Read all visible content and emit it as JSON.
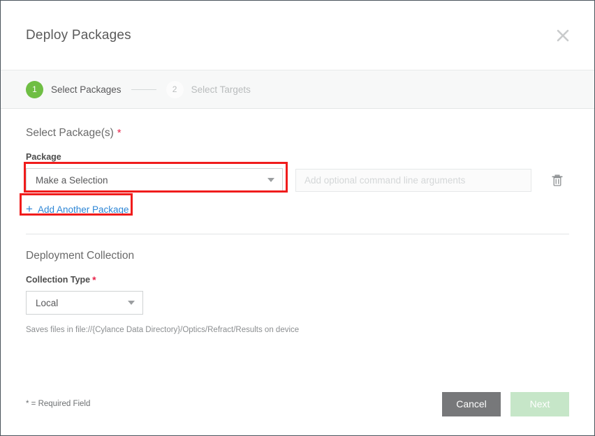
{
  "dialog": {
    "title": "Deploy Packages",
    "close_icon": "close-icon"
  },
  "stepper": {
    "steps": [
      {
        "number": "1",
        "label": "Select Packages",
        "state": "active"
      },
      {
        "number": "2",
        "label": "Select Targets",
        "state": "inactive"
      }
    ]
  },
  "packages_section": {
    "heading": "Select Package(s)",
    "required_marker": "*",
    "package_label": "Package",
    "package_select_value": "Make a Selection",
    "arguments_placeholder": "Add optional command line arguments",
    "arguments_value": "",
    "delete_icon": "trash-icon",
    "add_another_plus": "+",
    "add_another_label": "Add Another Package"
  },
  "collection_section": {
    "heading": "Deployment Collection",
    "type_label": "Collection Type",
    "required_marker": "*",
    "type_value": "Local",
    "help_text": "Saves files in file://{Cylance Data Directory}/Optics/Refract/Results on device"
  },
  "footer": {
    "required_note": "* = Required Field",
    "cancel_label": "Cancel",
    "next_label": "Next"
  },
  "colors": {
    "step_active": "#6fbe44",
    "link_blue": "#2e86d6",
    "required_red": "#e8234a",
    "annotation_red": "#f01c1c",
    "cancel_gray": "#77787a",
    "next_disabled_green": "#c6e6c8"
  }
}
